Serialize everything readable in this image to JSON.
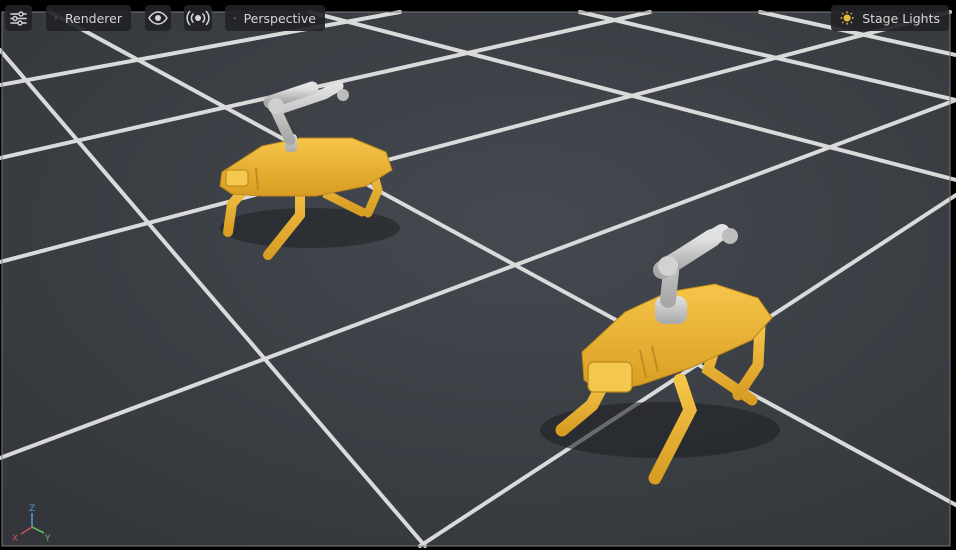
{
  "toolbar": {
    "renderer_label": "Renderer",
    "camera_label": "Perspective",
    "stage_lights_label": "Stage Lights"
  },
  "gizmo": {
    "x_label": "X",
    "y_label": "Y",
    "z_label": "Z"
  },
  "colors": {
    "ground": "#3b3f44",
    "grid_line": "#e8e8e8",
    "robot_body": "#e9b236",
    "robot_arm": "#c9c9c9",
    "toolbar_bg": "#222326",
    "toolbar_text": "#d6d6d6",
    "sun_icon": "#e7b93c"
  }
}
